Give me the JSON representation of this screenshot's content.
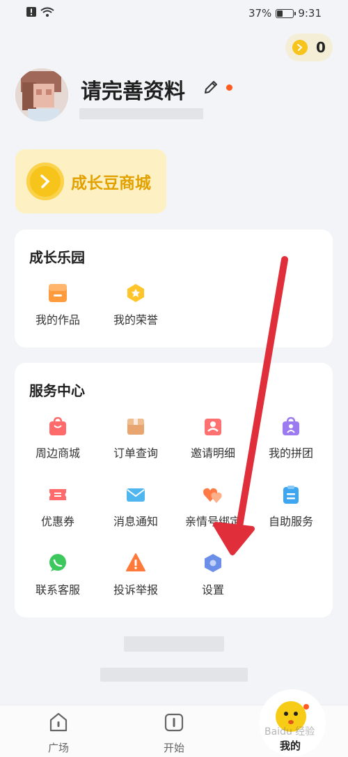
{
  "status_bar": {
    "battery": "37%",
    "battery_level": 0.37,
    "time": "9:31"
  },
  "coins": {
    "count": "0"
  },
  "profile": {
    "name": "请完善资料"
  },
  "mall": {
    "label": "成长豆商城"
  },
  "growth_park": {
    "title": "成长乐园",
    "items": [
      {
        "label": "我的作品",
        "icon": "works-icon"
      },
      {
        "label": "我的荣誉",
        "icon": "honor-icon"
      }
    ]
  },
  "service_center": {
    "title": "服务中心",
    "items": [
      {
        "label": "周边商城",
        "icon": "shopping-bag-icon"
      },
      {
        "label": "订单查询",
        "icon": "package-icon"
      },
      {
        "label": "邀请明细",
        "icon": "invite-icon"
      },
      {
        "label": "我的拼团",
        "icon": "group-buy-icon"
      },
      {
        "label": "优惠券",
        "icon": "coupon-icon"
      },
      {
        "label": "消息通知",
        "icon": "mail-icon"
      },
      {
        "label": "亲情号绑定",
        "icon": "hearts-icon"
      },
      {
        "label": "自助服务",
        "icon": "clipboard-icon"
      },
      {
        "label": "联系客服",
        "icon": "chat-icon"
      },
      {
        "label": "投诉举报",
        "icon": "warning-icon"
      },
      {
        "label": "设置",
        "icon": "settings-hexagon-icon"
      }
    ]
  },
  "bottom_nav": {
    "items": [
      {
        "label": "广场",
        "icon": "home-icon"
      },
      {
        "label": "开始",
        "icon": "start-icon"
      },
      {
        "label": "我的",
        "icon": "mascot-icon"
      }
    ]
  },
  "watermark": "Baidu 经验",
  "colors": {
    "accent_yellow": "#f7c41c",
    "mall_text": "#e3a100",
    "arrow_red": "#e02f3a",
    "dot_orange": "#ff5a1f"
  }
}
